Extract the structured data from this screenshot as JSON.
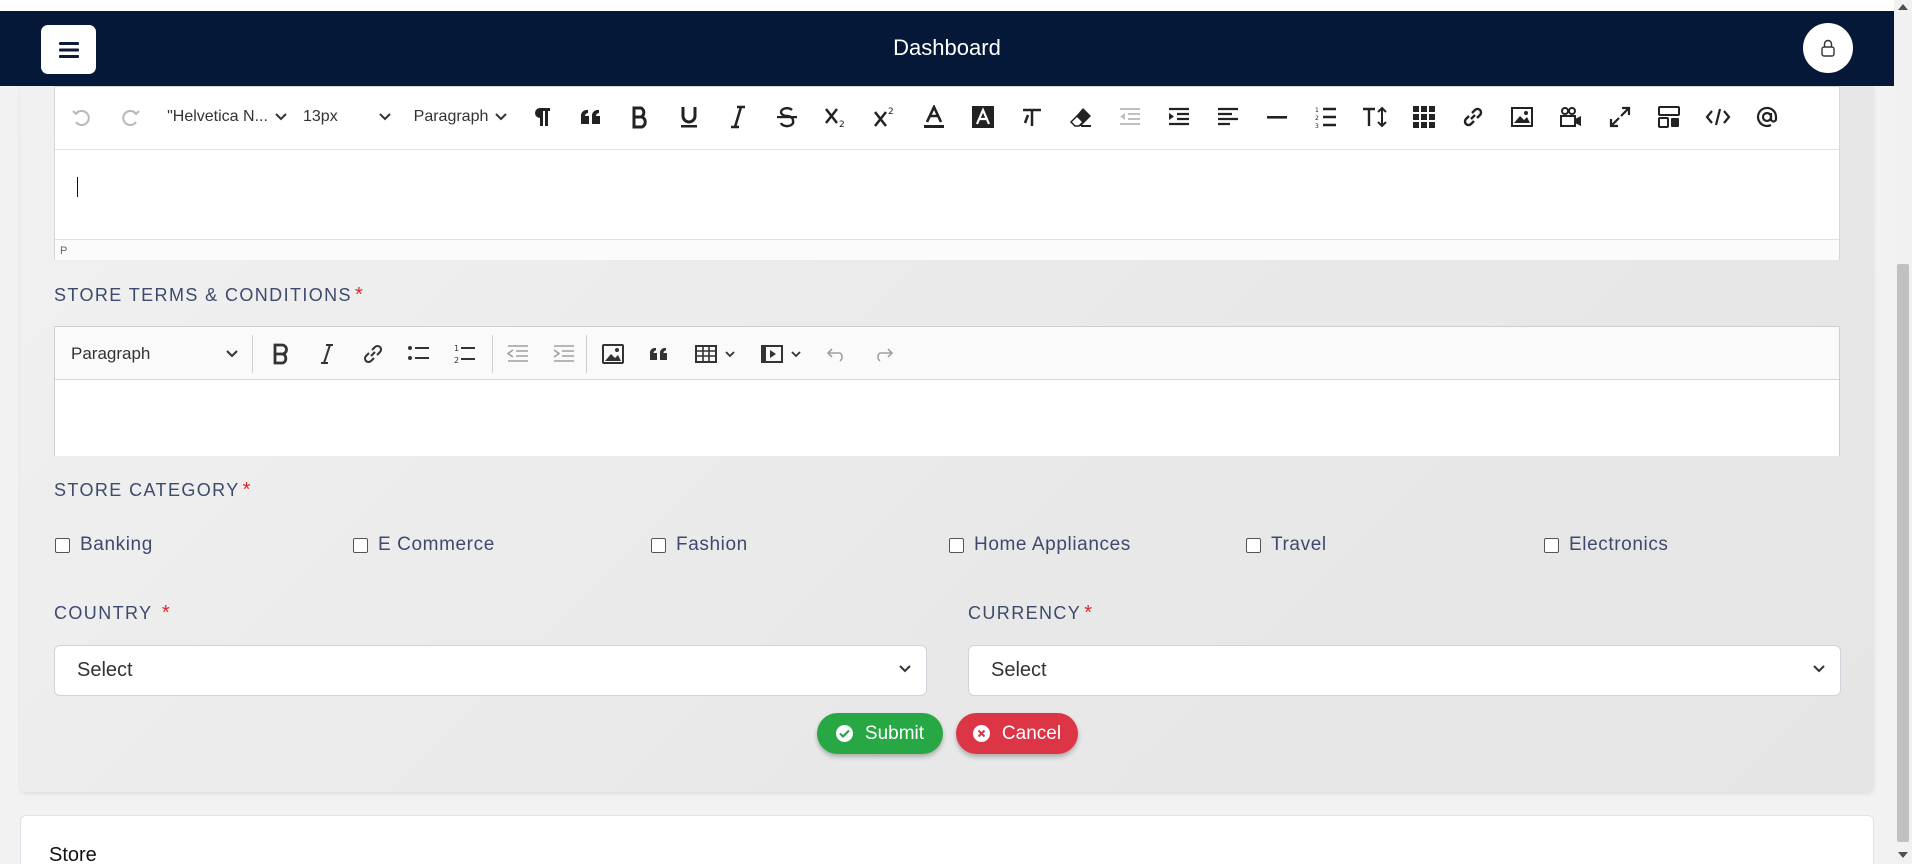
{
  "navbar": {
    "title": "Dashboard",
    "menu_icon": "hamburger-icon",
    "user_icon": "user-icon"
  },
  "editor_top": {
    "font_family": "\"Helvetica N...",
    "font_size": "13px",
    "block_format": "Paragraph",
    "status_path": "P"
  },
  "terms": {
    "label": "STORE TERMS & CONDITIONS",
    "required": "*",
    "block_format": "Paragraph"
  },
  "category": {
    "label": "STORE CATEGORY",
    "required": "*",
    "options": [
      "Banking",
      "E Commerce",
      "Fashion",
      "Home Appliances",
      "Travel",
      "Electronics"
    ]
  },
  "country": {
    "label": "COUNTRY",
    "required": "*",
    "value": "Select"
  },
  "currency": {
    "label": "CURRENCY",
    "required": "*",
    "value": "Select"
  },
  "actions": {
    "submit": "Submit",
    "cancel": "Cancel"
  },
  "next_section": {
    "title": "Store"
  },
  "colors": {
    "navbar": "#051838",
    "submit": "#28a745",
    "cancel": "#dc3545",
    "required": "#e0242c",
    "label": "#3d4a6b"
  }
}
